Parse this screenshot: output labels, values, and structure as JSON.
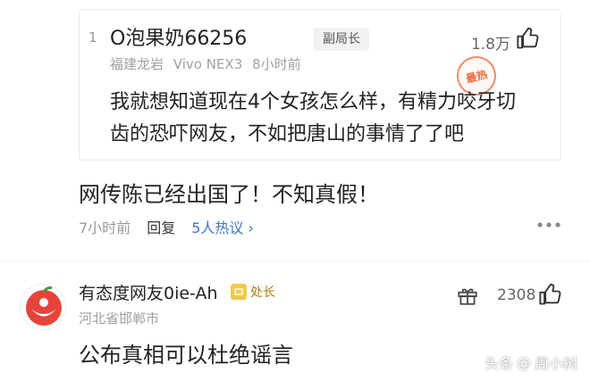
{
  "quoted_comment": {
    "index": "1",
    "username": "O泡果奶66256",
    "badge": "副局长",
    "location": "福建龙岩",
    "device": "Vivo NEX3",
    "time": "8小时前",
    "likes": "1.8万",
    "hot_stamp": "最热",
    "text": "我就想知道现在4个女孩怎么样，有精力咬牙切齿的恐吓网友，不如把唐山的事情了了吧"
  },
  "reply": {
    "text": "网传陈已经出国了！不知真假！",
    "time": "7小时前",
    "reply_label": "回复",
    "hot_replies": "5人热议",
    "hot_replies_chevron": "›"
  },
  "comment2": {
    "username": "有态度网友0ie-Ah",
    "badge": "处长",
    "location": "河北省邯郸市",
    "likes": "2308",
    "text": "公布真相可以杜绝谣言"
  },
  "watermark": {
    "brand": "头条",
    "at": "@",
    "author": "周小树"
  },
  "colors": {
    "link_blue": "#3b76c4",
    "hot_orange": "#f06a3f",
    "badge_gold": "#f2c94c"
  },
  "icons": [
    "thumbs-up-icon",
    "more-dots-icon",
    "gift-icon",
    "avatar-logo",
    "badge-icon",
    "hot-stamp"
  ]
}
